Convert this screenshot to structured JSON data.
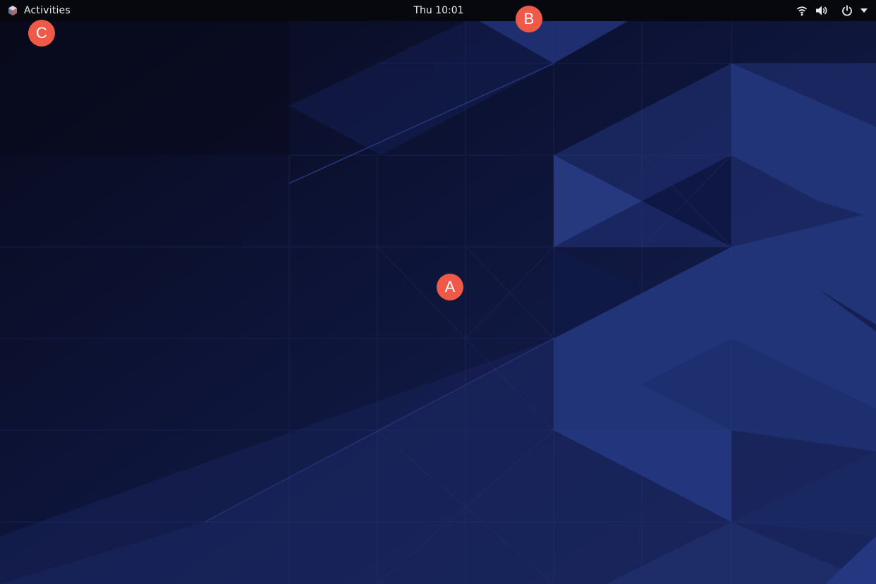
{
  "top_bar": {
    "activities_label": "Activities",
    "clock": "Thu 10:01",
    "icons": [
      "distro-logo-icon",
      "wifi-icon",
      "volume-icon",
      "power-icon",
      "dropdown-arrow-icon"
    ]
  },
  "markers": {
    "a": "A",
    "b": "B",
    "c": "C"
  },
  "colors": {
    "top_bar_bg": "#07080d",
    "wallpaper_dark": "#0b0f2a",
    "wallpaper_mid": "#16214f",
    "wallpaper_light": "#213478",
    "marker": "#ee5a47"
  }
}
